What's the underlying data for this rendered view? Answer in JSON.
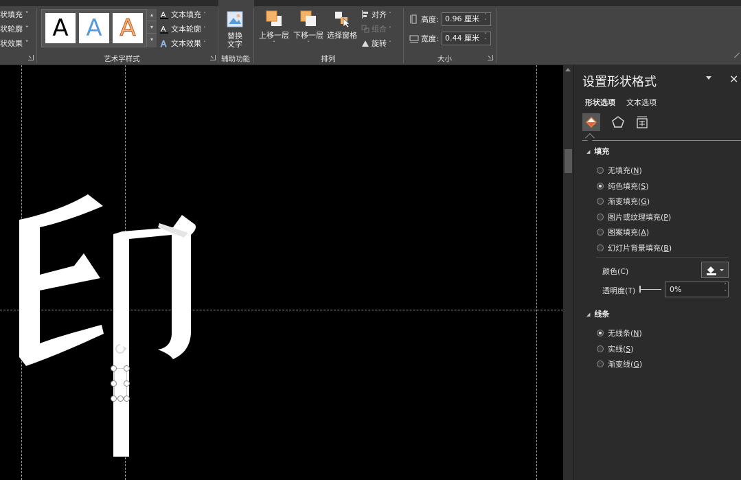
{
  "ribbon": {
    "shape_style_cmds": [
      {
        "label": "状填充 ˇ"
      },
      {
        "label": "状轮廓 ˇ"
      },
      {
        "label": "状效果 ˇ"
      }
    ],
    "wordart": {
      "swatch_letter": "A",
      "swatches": [
        {
          "name": "black",
          "color": "#000000"
        },
        {
          "name": "blue",
          "color": "#5b9bd5"
        },
        {
          "name": "orange",
          "color": "#f4b183"
        }
      ],
      "text_fill": "文本填充",
      "text_outline": "文本轮廓",
      "text_effects": "文本效果",
      "group_label": "艺术字样式"
    },
    "accessibility": {
      "alt_text_line1": "替换",
      "alt_text_line2": "文字",
      "group_label": "辅助功能"
    },
    "arrange": {
      "bring_forward": "上移一层",
      "send_backward": "下移一层",
      "selection_pane": "选择窗格",
      "align": "对齐",
      "group": "组合",
      "rotate": "旋转",
      "group_label": "排列"
    },
    "size": {
      "height_label": "高度:",
      "height_value": "0.96 厘米",
      "width_label": "宽度:",
      "width_value": "0.44 厘米",
      "group_label": "大小"
    }
  },
  "canvas": {
    "character": "印",
    "text_color": "#ffffff",
    "background": "#000000"
  },
  "pane": {
    "title": "设置形状格式",
    "close": "×",
    "tabs": [
      "形状选项",
      "文本选项"
    ],
    "fill_section": "填充",
    "fill_options": [
      {
        "label": "无填充(",
        "key": "N",
        "selected": false
      },
      {
        "label": "纯色填充(",
        "key": "S",
        "selected": true
      },
      {
        "label": "渐变填充(",
        "key": "G",
        "selected": false
      },
      {
        "label": "图片或纹理填充(",
        "key": "P",
        "selected": false
      },
      {
        "label": "图案填充(",
        "key": "A",
        "selected": false
      },
      {
        "label": "幻灯片背景填充(",
        "key": "B",
        "selected": false
      }
    ],
    "color_label": "颜色(C)",
    "transparency_label": "透明度(T)",
    "transparency_value": "0%",
    "line_section": "线条",
    "line_options": [
      {
        "label": "无线条(",
        "key": "N",
        "selected": true
      },
      {
        "label": "实线(",
        "key": "S",
        "selected": false
      },
      {
        "label": "渐变线(",
        "key": "G",
        "selected": false
      }
    ]
  }
}
